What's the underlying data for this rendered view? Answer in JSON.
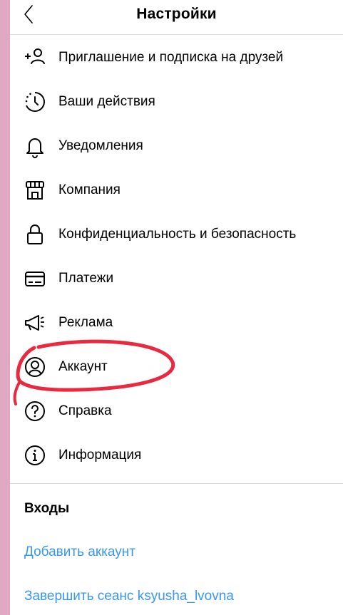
{
  "header": {
    "title": "Настройки"
  },
  "menu": {
    "items": [
      {
        "label": "Приглашение и подписка на друзей",
        "icon": "add-friend-icon"
      },
      {
        "label": "Ваши действия",
        "icon": "activity-clock-icon"
      },
      {
        "label": "Уведомления",
        "icon": "bell-icon"
      },
      {
        "label": "Компания",
        "icon": "shop-icon"
      },
      {
        "label": "Конфиденциальность и безопасность",
        "icon": "lock-icon"
      },
      {
        "label": "Платежи",
        "icon": "card-icon"
      },
      {
        "label": "Реклама",
        "icon": "megaphone-icon"
      },
      {
        "label": "Аккаунт",
        "icon": "account-circle-icon"
      },
      {
        "label": "Справка",
        "icon": "help-icon"
      },
      {
        "label": "Информация",
        "icon": "info-icon"
      }
    ]
  },
  "logins": {
    "title": "Входы",
    "add_account": "Добавить аккаунт",
    "logout": "Завершить сеанс ksyusha_lvovna"
  },
  "colors": {
    "background_border": "#e0a8c3",
    "link": "#3897f0",
    "highlight_stroke": "#e8293f"
  }
}
